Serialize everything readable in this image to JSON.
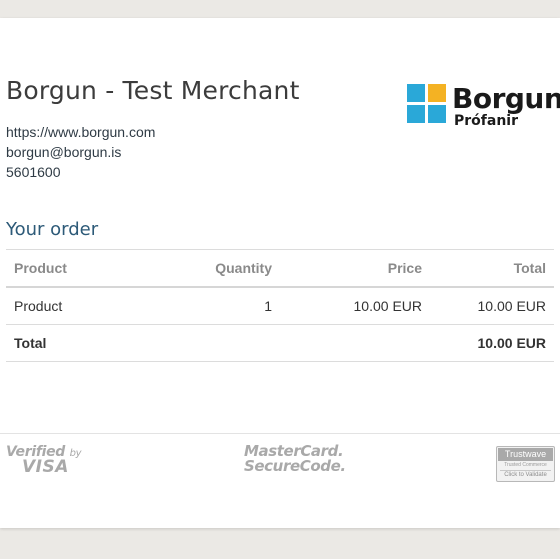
{
  "merchant": {
    "name": "Borgun - Test Merchant",
    "website": "https://www.borgun.com",
    "email": "borgun@borgun.is",
    "phone": "5601600"
  },
  "logo": {
    "word": "Borgun",
    "subtitle": "Prófanir",
    "colors": {
      "blue": "#2aa8d8",
      "yellow": "#f4b223"
    }
  },
  "order": {
    "heading": "Your order",
    "columns": [
      "Product",
      "Quantity",
      "Price",
      "Total"
    ],
    "rows": [
      {
        "product": "Product",
        "quantity": "1",
        "price": "10.00 EUR",
        "total": "10.00 EUR"
      }
    ],
    "total_label": "Total",
    "total_value": "10.00 EUR"
  },
  "footer": {
    "visa_line1": "Verified",
    "visa_by": "by",
    "visa_line2": "VISA",
    "mastercard_line1": "MasterCard.",
    "mastercard_line2": "SecureCode.",
    "trustwave_title": "Trustwave",
    "trustwave_sub": "Trusted Commerce",
    "trustwave_action": "Click to Validate"
  }
}
